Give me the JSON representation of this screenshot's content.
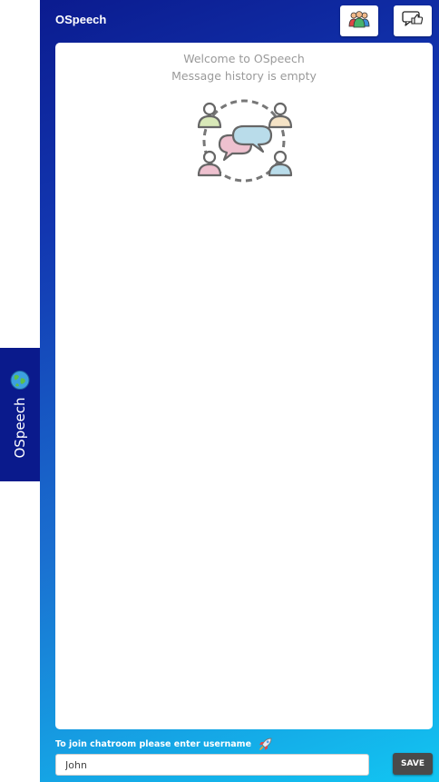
{
  "app": {
    "title": "OSpeech"
  },
  "side_tab": {
    "label": "OSpeech",
    "icon": "globe-icon"
  },
  "header": {
    "users_button_icon": "users-icon",
    "feedback_button_icon": "thumbs-up-icon"
  },
  "chat": {
    "welcome_line1": "Welcome to OSpeech",
    "welcome_line2": "Message history is empty",
    "illustration_icon": "chat-group-icon"
  },
  "join": {
    "prompt": "To join chatroom please enter username",
    "prompt_icon": "rocket-icon",
    "username_value": "John",
    "save_label": "SAVE"
  },
  "colors": {
    "panel_top": "#0b1b8f",
    "panel_bottom": "#12c6f2",
    "side_tab": "#0a1a8c",
    "save_button": "#4a4a4a"
  }
}
